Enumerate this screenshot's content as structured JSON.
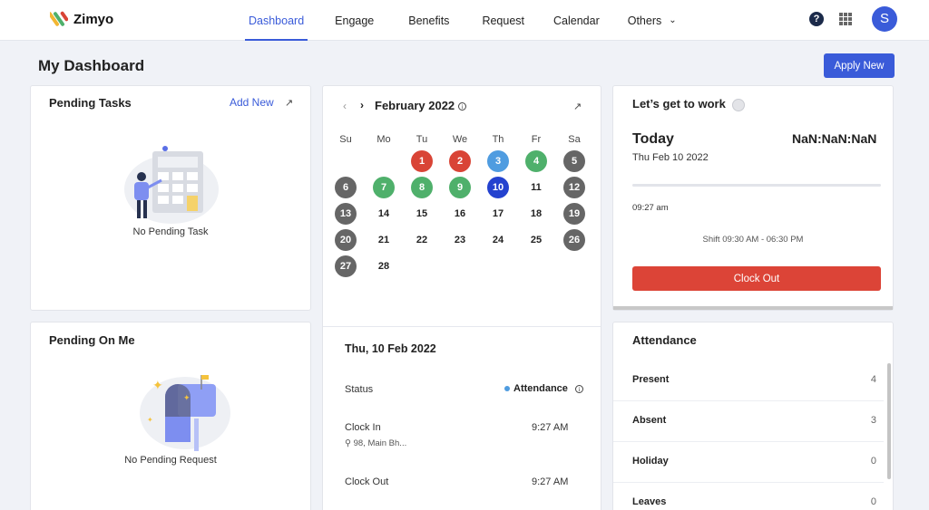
{
  "app": {
    "brand": "Zimyo"
  },
  "nav": {
    "items": [
      "Dashboard",
      "Engage",
      "Benefits",
      "Request",
      "Calendar",
      "Others"
    ],
    "active": "Dashboard"
  },
  "user": {
    "initial": "S"
  },
  "header": {
    "title": "My Dashboard",
    "apply_label": "Apply New"
  },
  "pending_tasks": {
    "title": "Pending Tasks",
    "add_label": "Add New",
    "empty": "No Pending Task"
  },
  "pending_on_me": {
    "title": "Pending On Me",
    "empty": "No Pending Request"
  },
  "calendar": {
    "month": "February 2022",
    "weekdays": [
      "Su",
      "Mo",
      "Tu",
      "We",
      "Th",
      "Fr",
      "Sa"
    ],
    "days": [
      {
        "d": "1",
        "s": "red"
      },
      {
        "d": "2",
        "s": "red"
      },
      {
        "d": "3",
        "s": "blue"
      },
      {
        "d": "4",
        "s": "green"
      },
      {
        "d": "5",
        "s": "grey"
      },
      {
        "d": "6",
        "s": "grey"
      },
      {
        "d": "7",
        "s": "green"
      },
      {
        "d": "8",
        "s": "green"
      },
      {
        "d": "9",
        "s": "green"
      },
      {
        "d": "10",
        "s": "today"
      },
      {
        "d": "11",
        "s": ""
      },
      {
        "d": "12",
        "s": "grey"
      },
      {
        "d": "13",
        "s": "grey"
      },
      {
        "d": "14",
        "s": ""
      },
      {
        "d": "15",
        "s": ""
      },
      {
        "d": "16",
        "s": ""
      },
      {
        "d": "17",
        "s": ""
      },
      {
        "d": "18",
        "s": ""
      },
      {
        "d": "19",
        "s": "grey"
      },
      {
        "d": "20",
        "s": "grey"
      },
      {
        "d": "21",
        "s": ""
      },
      {
        "d": "22",
        "s": ""
      },
      {
        "d": "23",
        "s": ""
      },
      {
        "d": "24",
        "s": ""
      },
      {
        "d": "25",
        "s": ""
      },
      {
        "d": "26",
        "s": "grey"
      },
      {
        "d": "27",
        "s": "grey"
      },
      {
        "d": "28",
        "s": ""
      }
    ],
    "first_weekday": 2,
    "colors": {
      "red": "#d94436",
      "blue": "#4f9ce0",
      "green": "#4fb06b",
      "grey": "#666666",
      "today": "#2442cf"
    }
  },
  "day_detail": {
    "date": "Thu, 10 Feb 2022",
    "status_label": "Status",
    "status_value": "Attendance",
    "clock_in_label": "Clock In",
    "clock_in_time": "9:27 AM",
    "clock_in_location": "98, Main Bh...",
    "clock_out_label": "Clock Out",
    "clock_out_time": "9:27 AM"
  },
  "work": {
    "title": "Let’s get to work",
    "today_label": "Today",
    "timer": "NaN:NaN:NaN",
    "date": "Thu Feb 10 2022",
    "clock_in_time": "09:27 am",
    "shift": "Shift 09:30 AM - 06:30 PM",
    "clock_out_label": "Clock Out"
  },
  "attendance": {
    "title": "Attendance",
    "rows": [
      {
        "label": "Present",
        "value": "4"
      },
      {
        "label": "Absent",
        "value": "3"
      },
      {
        "label": "Holiday",
        "value": "0"
      },
      {
        "label": "Leaves",
        "value": "0"
      }
    ]
  },
  "theme": {
    "accent": "#3a5bd9",
    "danger": "#dc4437"
  }
}
